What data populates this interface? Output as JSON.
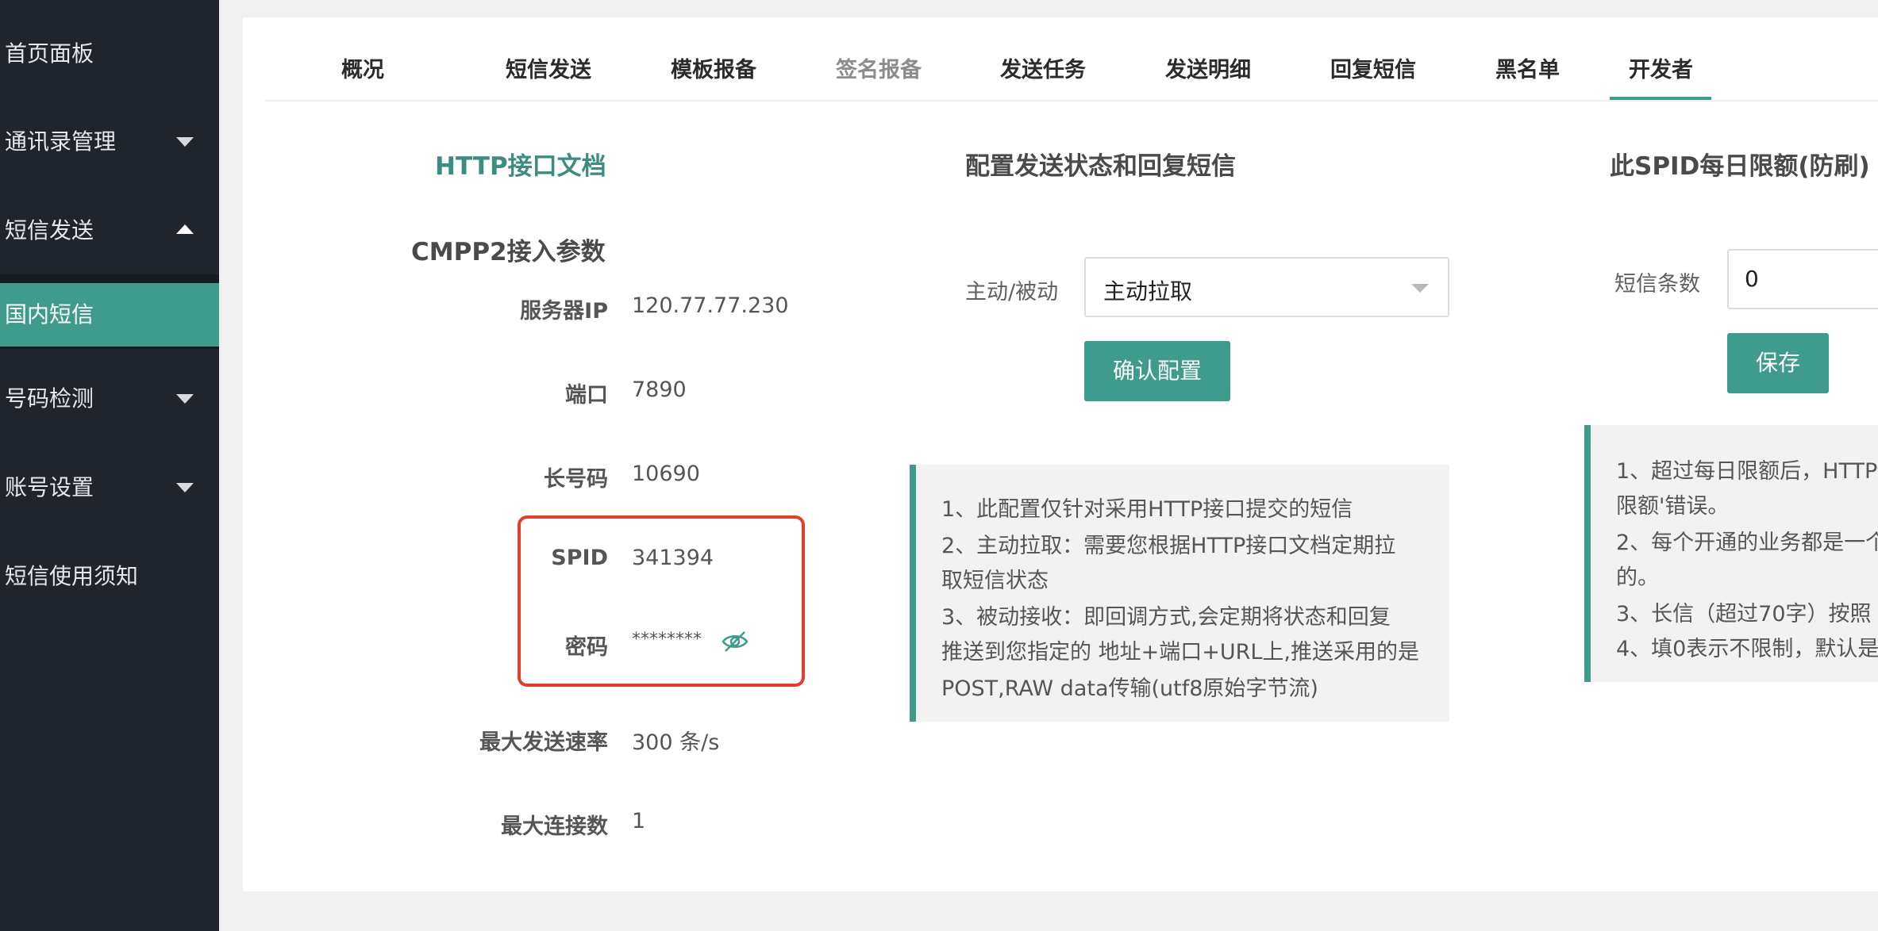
{
  "sidebar": {
    "items": [
      {
        "label": "首页面板"
      },
      {
        "label": "通讯录管理"
      },
      {
        "label": "短信发送"
      },
      {
        "label": "国内短信"
      },
      {
        "label": "号码检测"
      },
      {
        "label": "账号设置"
      },
      {
        "label": "短信使用须知"
      }
    ]
  },
  "tabs": [
    "概况",
    "短信发送",
    "模板报备",
    "签名报备",
    "发送任务",
    "发送明细",
    "回复短信",
    "黑名单",
    "开发者"
  ],
  "active_tab": "开发者",
  "left": {
    "http_doc_link": "HTTP接口文档",
    "cmpp_title": "CMPP2接入参数",
    "params": [
      {
        "label": "服务器IP",
        "value": "120.77.77.230"
      },
      {
        "label": "端口",
        "value": "7890"
      },
      {
        "label": "长号码",
        "value": "10690"
      },
      {
        "label": "SPID",
        "value": "341394"
      },
      {
        "label": "密码",
        "value": "********"
      },
      {
        "label": "最大发送速率",
        "value": "300 条/s"
      },
      {
        "label": "最大连接数",
        "value": "1"
      }
    ]
  },
  "middle": {
    "title": "配置发送状态和回复短信",
    "mode_label": "主动/被动",
    "mode_value": "主动拉取",
    "confirm_button": "确认配置",
    "notes": [
      "1、此配置仅针对采用HTTP接口提交的短信",
      "2、主动拉取：需要您根据HTTP接口文档定期拉",
      "取短信状态",
      "3、被动接收：即回调方式,会定期将状态和回复",
      "推送到您指定的 地址+端口+URL上,推送采用的是",
      "POST,RAW data传输(utf8原始字节流)"
    ]
  },
  "right": {
    "title": "此SPID每日限额(防刷)",
    "count_label": "短信条数",
    "count_value": "0",
    "save_button": "保存",
    "notes": [
      "1、超过每日限额后，HTTP",
      "限额'错误。",
      "2、每个开通的业务都是一个",
      "的。",
      "3、长信（超过70字）按照",
      "4、填0表示不限制，默认是"
    ]
  },
  "colors": {
    "accent": "#3f9b8c",
    "sidebar_bg": "#1f242d",
    "highlight_border": "#e0402b"
  }
}
